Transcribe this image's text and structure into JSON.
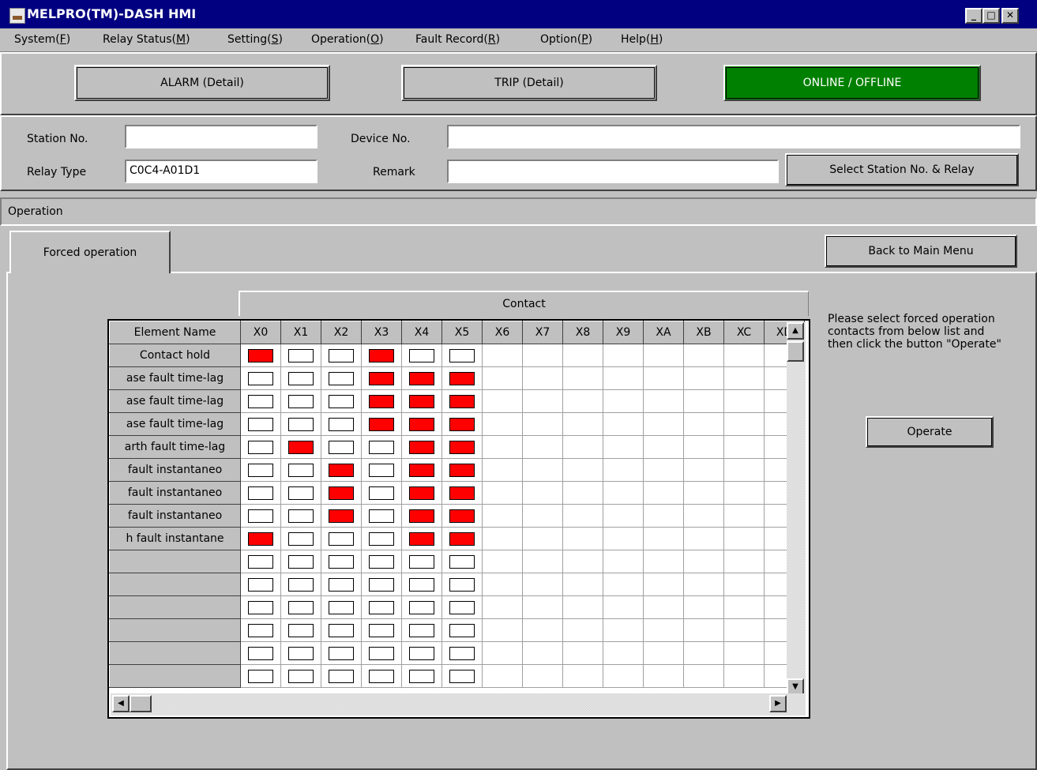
{
  "window": {
    "title": "MELPRO(TM)-DASH HMI",
    "controls": {
      "minimize": "_",
      "maximize": "□",
      "close": "✕"
    }
  },
  "menu": [
    {
      "label": "System(",
      "key": "F"
    },
    {
      "label": "Relay Status(",
      "key": "M"
    },
    {
      "label": "Setting(",
      "key": "S"
    },
    {
      "label": "Operation(",
      "key": "O"
    },
    {
      "label": "Fault Record(",
      "key": "R"
    },
    {
      "label": "Option(",
      "key": "P"
    },
    {
      "label": "Help(",
      "key": "H"
    }
  ],
  "status": {
    "alarm": "ALARM (Detail)",
    "trip": "TRIP (Detail)",
    "online": "ONLINE / OFFLINE",
    "online_color": "#008000"
  },
  "info": {
    "station_label": "Station No.",
    "station_value": "",
    "relay_type_label": "Relay Type",
    "relay_type_value": "C0C4-A01D1",
    "device_label": "Device No.",
    "device_value": "",
    "remark_label": "Remark",
    "remark_value": "",
    "select_button": "Select Station No. & Relay"
  },
  "section": {
    "title": "Operation"
  },
  "tabs": [
    {
      "label": "Forced operation",
      "active": true
    }
  ],
  "back_button": "Back to Main Menu",
  "grid": {
    "contact_header": "Contact",
    "element_header": "Element Name",
    "columns": [
      "X0",
      "X1",
      "X2",
      "X3",
      "X4",
      "X5",
      "X6",
      "X7",
      "X8",
      "X9",
      "XA",
      "XB",
      "XC",
      "XD"
    ],
    "visible_box_columns": 6,
    "rows": [
      {
        "name": "Contact hold",
        "states": [
          1,
          0,
          0,
          1,
          0,
          0
        ]
      },
      {
        "name": "ase fault time-lag",
        "states": [
          0,
          0,
          0,
          1,
          1,
          1
        ]
      },
      {
        "name": "ase fault time-lag",
        "states": [
          0,
          0,
          0,
          1,
          1,
          1
        ]
      },
      {
        "name": "ase fault time-lag",
        "states": [
          0,
          0,
          0,
          1,
          1,
          1
        ]
      },
      {
        "name": "arth fault time-lag",
        "states": [
          0,
          1,
          0,
          0,
          1,
          1
        ]
      },
      {
        "name": "fault instantaneo",
        "states": [
          0,
          0,
          1,
          0,
          1,
          1
        ]
      },
      {
        "name": "fault instantaneo",
        "states": [
          0,
          0,
          1,
          0,
          1,
          1
        ]
      },
      {
        "name": "fault instantaneo",
        "states": [
          0,
          0,
          1,
          0,
          1,
          1
        ]
      },
      {
        "name": "h fault instantane",
        "states": [
          1,
          0,
          0,
          0,
          1,
          1
        ]
      },
      {
        "name": "",
        "states": [
          0,
          0,
          0,
          0,
          0,
          0
        ]
      },
      {
        "name": "",
        "states": [
          0,
          0,
          0,
          0,
          0,
          0
        ]
      },
      {
        "name": "",
        "states": [
          0,
          0,
          0,
          0,
          0,
          0
        ]
      },
      {
        "name": "",
        "states": [
          0,
          0,
          0,
          0,
          0,
          0
        ]
      },
      {
        "name": "",
        "states": [
          0,
          0,
          0,
          0,
          0,
          0
        ]
      },
      {
        "name": "",
        "states": [
          0,
          0,
          0,
          0,
          0,
          0
        ]
      }
    ],
    "on_color": "#ff0000"
  },
  "instructions": "Please select forced operation contacts from below list and then click the button \"Operate\"",
  "operate_button": "Operate"
}
